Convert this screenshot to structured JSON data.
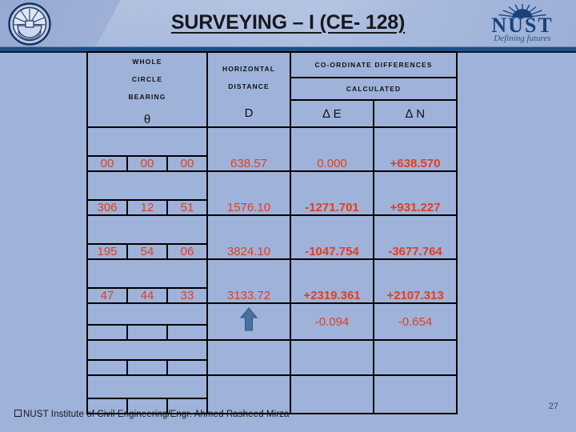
{
  "header": {
    "title": "SURVEYING – I (CE- 128)",
    "brand_name": "NUST",
    "brand_tagline": "Defining futures",
    "seal_icon": "nust-seal-icon",
    "rays_icon": "nust-rays-icon"
  },
  "table": {
    "headers": {
      "whole": "WHOLE",
      "circle": "CIRCLE",
      "bearing": "BEARING",
      "theta": "θ",
      "horizontal": "HORIZONTAL",
      "distance": "DISTANCE",
      "d_symbol": "D",
      "coordinate_differences": "CO-ORDINATE DIFFERENCES",
      "calculated": "CALCULATED",
      "delta_e": "∆ E",
      "delta_n": "∆ N"
    },
    "rows": [
      {
        "deg": "00",
        "min": "00",
        "sec": "00",
        "distance": "638.57",
        "delta_e": "0.000",
        "delta_n": "+638.570",
        "bold": false
      },
      {
        "deg": "306",
        "min": "12",
        "sec": "51",
        "distance": "1576.10",
        "delta_e": "-1271.701",
        "delta_n": "+931.227",
        "bold": true
      },
      {
        "deg": "195",
        "min": "54",
        "sec": "06",
        "distance": "3824.10",
        "delta_e": "-1047.754",
        "delta_n": "-3677.764",
        "bold": true
      },
      {
        "deg": "47",
        "min": "44",
        "sec": "33",
        "distance": "3133.72",
        "delta_e": "+2319.361",
        "delta_n": "+2107.313",
        "bold": true
      }
    ],
    "totals": {
      "delta_e": "-0.094",
      "delta_n": "-0.654"
    },
    "arrow_icon": "up-arrow-icon",
    "arrow_color": "#49719f",
    "empty_rows": 2
  },
  "footer": {
    "credit": "NUST Institute of Civil Engineering/Engr. Ahmed Rasheed Mirza",
    "page_number": "27"
  },
  "colors": {
    "background": "#9fb2d9",
    "value_red": "#e03f20",
    "brand_blue": "#17427c",
    "rule_blue": "#1f4f86"
  }
}
